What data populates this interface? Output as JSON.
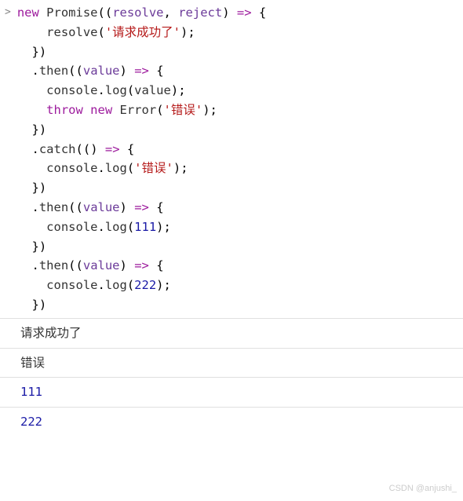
{
  "code": {
    "tokens": {
      "new": "new",
      "Promise": "Promise",
      "resolve": "resolve",
      "reject": "reject",
      "arrow": "=>",
      "lbrace": "{",
      "rbrace": "}",
      "lparen": "(",
      "rparen": ")",
      "comma": ",",
      "semi": ";",
      "dot": ".",
      "resolveCall": "resolve",
      "str1": "'请求成功了'",
      "then": "then",
      "value": "value",
      "console": "console",
      "log": "log",
      "throw": "throw",
      "Error": "Error",
      "str2": "'错误'",
      "catch": "catch",
      "str3": "'错误'",
      "num1": "111",
      "num2": "222",
      "space": " "
    }
  },
  "output": {
    "line1": "请求成功了",
    "line2": "错误",
    "line3": "111",
    "line4": "222"
  },
  "prompt": ">",
  "watermark": "CSDN @anjushi_"
}
